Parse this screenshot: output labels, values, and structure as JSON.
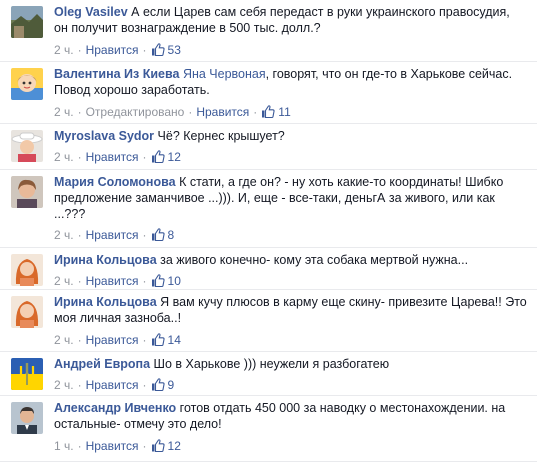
{
  "comments": [
    {
      "author": "Oleg Vasilev",
      "mention": "",
      "text": "А если Царев сам себя передаст в руки украинского правосудия, он получит вознаграждение в 500 тыс. долл.?",
      "time": "2 ч.",
      "edited": "",
      "like_label": "Нравится",
      "likes": "53",
      "avatar": "landscape-photo"
    },
    {
      "author": "Валентина Из Киева",
      "mention": "Яна Червоная",
      "text": ", говорят, что он где-то в Харькове сейчас. Повод хорошо заработать.",
      "time": "2 ч.",
      "edited": "Отредактировано",
      "like_label": "Нравится",
      "likes": "11",
      "avatar": "cartoon-girl"
    },
    {
      "author": "Myroslava Sydor",
      "mention": "",
      "text": "Чё? Кернес крышует?",
      "time": "2 ч.",
      "edited": "",
      "like_label": "Нравится",
      "likes": "12",
      "avatar": "woman-hat"
    },
    {
      "author": "Мария Соломонова",
      "mention": "",
      "text": "К стати, а где он? - ну хоть какие-то координаты! Шибко предложение заманчивое ...))). И, еще - все-таки, деньгА за живого, или как ...???",
      "time": "2 ч.",
      "edited": "",
      "like_label": "Нравится",
      "likes": "8",
      "avatar": "woman-portrait"
    },
    {
      "author": "Ирина Кольцова",
      "mention": "",
      "text": "за живого конечно- кому эта собака мертвой нужна...",
      "time": "2 ч.",
      "edited": "",
      "like_label": "Нравится",
      "likes": "10",
      "avatar": "redhead-woman"
    },
    {
      "author": "Ирина Кольцова",
      "mention": "",
      "text": "Я вам кучу плюсов в карму еще скину- привезите Царева!! Это моя личная зазноба..!",
      "time": "2 ч.",
      "edited": "",
      "like_label": "Нравится",
      "likes": "14",
      "avatar": "redhead-woman"
    },
    {
      "author": "Андрей Европа",
      "mention": "",
      "text": "Шо в Харькове ))) неужели я разбогатею",
      "time": "2 ч.",
      "edited": "",
      "like_label": "Нравится",
      "likes": "9",
      "avatar": "trident-emblem"
    },
    {
      "author": "Александр Ивченко",
      "mention": "",
      "text": "готов отдать 450 000 за наводку о местонахождении. на остальные- отмечу это дело!",
      "time": "1 ч.",
      "edited": "",
      "like_label": "Нравится",
      "likes": "12",
      "avatar": "man-portrait"
    }
  ],
  "colors": {
    "link": "#3b5998",
    "meta": "#90949c",
    "divider": "#e9eaed"
  },
  "icons": {
    "like": "thumbs-up-icon"
  }
}
